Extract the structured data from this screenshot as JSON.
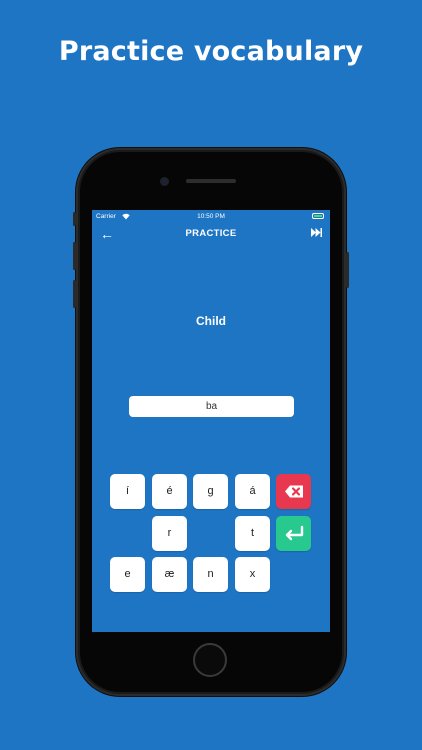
{
  "headline": "Practice vocabulary",
  "status_bar": {
    "carrier": "Carrier",
    "wifi_icon": "wifi-icon",
    "time": "10:50 PM",
    "battery_icon": "battery-icon"
  },
  "nav": {
    "back_icon": "←",
    "title": "PRACTICE",
    "skip_icon": "⏭"
  },
  "prompt_word": "Child",
  "answer_input": {
    "value": "ba"
  },
  "keyboard": {
    "row1": [
      "í",
      "é",
      "g",
      "á"
    ],
    "row2": [
      "r",
      "t"
    ],
    "row3": [
      "e",
      "æ",
      "n",
      "x"
    ],
    "delete_icon": "backspace-icon",
    "enter_icon": "enter-icon"
  },
  "colors": {
    "background": "#1d75c4",
    "delete_key": "#e8384f",
    "enter_key": "#28c98e"
  }
}
